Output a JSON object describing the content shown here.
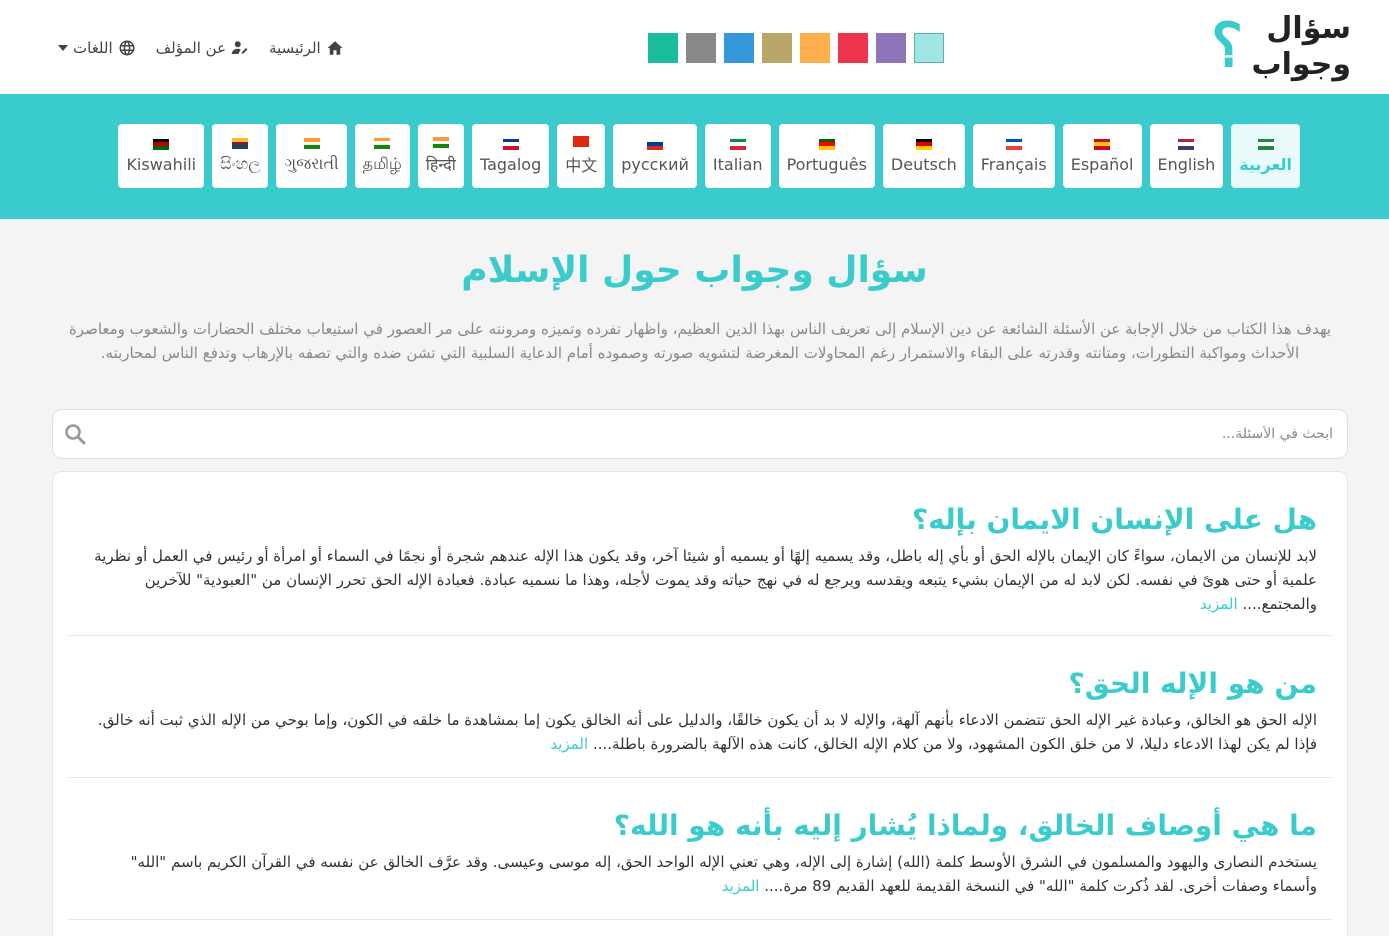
{
  "header": {
    "logo_line1": "سؤال",
    "logo_line2": "وجواب",
    "logo_mark": "؟",
    "nav": {
      "home": "الرئيسية",
      "about": "عن المؤلف",
      "languages": "اللغات"
    },
    "swatches": [
      "#1abc9c",
      "#888888",
      "#3498db",
      "#b8a66b",
      "#ffb04d",
      "#f0344f",
      "#8e74b8",
      "#a0e6e6"
    ]
  },
  "languages": [
    {
      "label": "العربية",
      "flag": [
        "#1e8a3e",
        "#ffffff",
        "#1e8a3e"
      ],
      "active": true
    },
    {
      "label": "English",
      "flag": [
        "#b22234",
        "#ffffff",
        "#3c3b6e"
      ]
    },
    {
      "label": "Español",
      "flag": [
        "#c60b1e",
        "#ffc400",
        "#c60b1e"
      ]
    },
    {
      "label": "Français",
      "flag": [
        "#0055a4",
        "#ffffff",
        "#ef4135"
      ]
    },
    {
      "label": "Deutsch",
      "flag": [
        "#000000",
        "#dd0000",
        "#ffce00"
      ]
    },
    {
      "label": "Português",
      "flag": [
        "#006600",
        "#ff0000",
        "#ffcc00"
      ]
    },
    {
      "label": "Italian",
      "flag": [
        "#009246",
        "#ffffff",
        "#ce2b37"
      ]
    },
    {
      "label": "русский",
      "flag": [
        "#ffffff",
        "#0039a6",
        "#d52b1e"
      ]
    },
    {
      "label": "中文",
      "flag": [
        "#de2910",
        "#de2910",
        "#de2910"
      ]
    },
    {
      "label": "Tagalog",
      "flag": [
        "#0038a8",
        "#ffffff",
        "#ce1126"
      ]
    },
    {
      "label": "हिन्दी",
      "flag": [
        "#ff9933",
        "#ffffff",
        "#138808"
      ]
    },
    {
      "label": "தமிழ்",
      "flag": [
        "#ff9933",
        "#ffffff",
        "#138808"
      ]
    },
    {
      "label": "ગુજરાતી",
      "flag": [
        "#ff9933",
        "#ffffff",
        "#138808"
      ]
    },
    {
      "label": "සිංහල",
      "flag": [
        "#ffbe29",
        "#8d153a",
        "#00534e"
      ]
    },
    {
      "label": "Kiswahili",
      "flag": [
        "#000000",
        "#bb0000",
        "#006600"
      ]
    }
  ],
  "hero": {
    "title": "سؤال وجواب حول الإسلام",
    "description": "يهدف هذا الكتاب من خلال الإجابة عن الأسئلة الشائعة عن دين الإسلام إلى تعريف الناس بهذا الدين العظيم، واظهار تفرده وتميزه ومرونته على مر العصور في استيعاب مختلف الحضارات والشعوب ومعاصرة الأحداث ومواكبة التطورات، ومتانته وقدرته على البقاء والاستمرار رغم المحاولات المغرضة لتشويه صورته وصموده أمام الدعاية السلبية التي تشن ضده والتي تصفه بالإرهاب وتدفع الناس لمحاربته."
  },
  "search": {
    "placeholder": "ابحث في الأسئلة..."
  },
  "questions": [
    {
      "title": "هل على الإنسان الايمان بإله؟",
      "excerpt": "لابد للإنسان من الايمان، سواءً كان الإيمان بالإله الحق أو بأي إله باطل، وقد يسميه إلهًا أو يسميه أو شيئا آخر، وقد يكون هذا الإله عندهم شجرة أو نجمًا في السماء أو امرأة أو رئيس في العمل أو نظرية علمية أو حتى هوىً في نفسه. لكن لابد له من الإيمان بشيء يتبعه ويقدسه ويرجع له في نهج حياته وقد يموت لأجله، وهذا ما نسميه عبادة. فعبادة الإله الحق تحرر الإنسان من \"العبودية\" للآخرين والمجتمع....",
      "more": "المزيد"
    },
    {
      "title": "من هو الإله الحق؟",
      "excerpt": "الإله الحق هو الخالق، وعبادة غير الإله الحق تتضمن الادعاء بأنهم آلهة، والإله لا بد أن يكون خالقًا، والدليل على أنه الخالق يكون إما بمشاهدة ما خلقه في الكون، وإما بوحي من الإله الذي ثبت أنه خالق. فإذا لم يكن لهذا الادعاء دليلا، لا من خلق الكون المشهود، ولا من كلام الإله الخالق، كانت هذه الآلهة بالضرورة باطلة....",
      "more": "المزيد"
    },
    {
      "title": "ما هي أوصاف الخالق، ولماذا يُشار إليه بأنه هو الله؟",
      "excerpt": "يستخدم النصارى واليهود والمسلمون في الشرق الأوسط كلمة (الله) إشارة إلى الإله، وهي تعني الإله الواحد الحق، إله موسى وعيسى. وقد عرَّف الخالق عن نفسه في القرآن الكريم باسم \"الله\" وأسماء وصفات أخرى. لقد ذُكرت كلمة \"الله\" في النسخة القديمة للعهد القديم 89 مرة....",
      "more": "المزيد"
    }
  ]
}
